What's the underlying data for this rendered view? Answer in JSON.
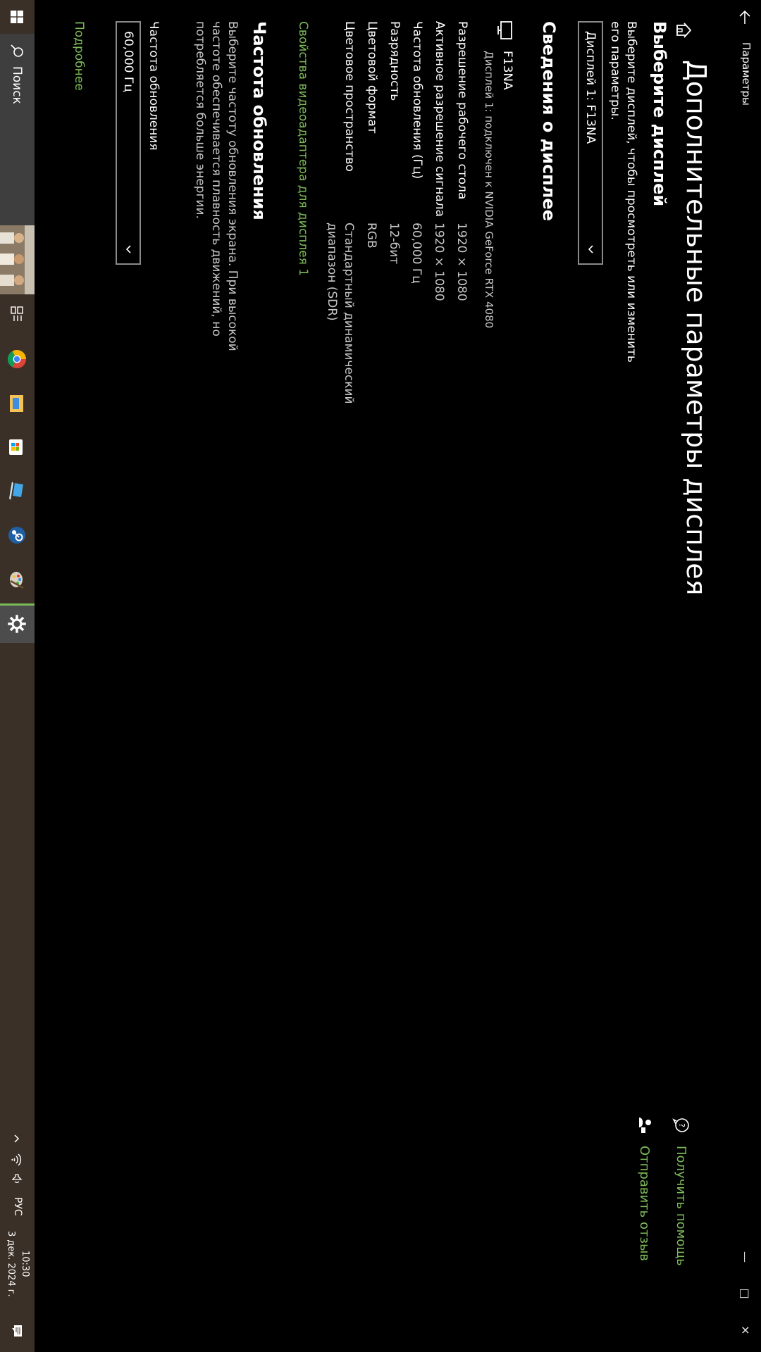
{
  "window": {
    "app_title": "Параметры",
    "minimize": "—",
    "restore": "□",
    "close": "✕"
  },
  "page": {
    "title": "Дополнительные параметры дисплея"
  },
  "help": {
    "get_help": "Получить помощь",
    "feedback": "Отправить отзыв"
  },
  "choose_display": {
    "heading": "Выберите дисплей",
    "description": "Выберите дисплей, чтобы просмотреть или изменить его параметры.",
    "selected": "Дисплей 1: F13NA"
  },
  "display_info": {
    "heading": "Сведения о дисплее",
    "name": "F13NA",
    "subtitle": "Дисплей 1: подключен к NVIDIA GeForce RTX 4080",
    "rows": [
      {
        "label": "Разрешение рабочего стола",
        "value": "1920 × 1080"
      },
      {
        "label": "Активное разрешение сигнала",
        "value": "1920 × 1080"
      },
      {
        "label": "Частота обновления (Гц)",
        "value": "60,000 Гц"
      },
      {
        "label": "Разрядность",
        "value": "12-бит"
      },
      {
        "label": "Цветовой формат",
        "value": "RGB"
      },
      {
        "label": "Цветовое пространство",
        "value": "Стандартный динамический диапазон (SDR)"
      }
    ],
    "adapter_link": "Свойства видеоадаптера для дисплея 1"
  },
  "refresh": {
    "heading": "Частота обновления",
    "description": "Выберите частоту обновления экрана. При высокой частоте обеспечивается плавность движений, но потребляется больше энергии.",
    "field_label": "Частота обновления",
    "selected": "60,000 Гц",
    "more_link": "Подробнее"
  },
  "taskbar": {
    "search_label": "Поиск",
    "language": "РУС",
    "time": "10:30",
    "date": "3 дек. 2024 г."
  },
  "colors": {
    "accent": "#7cba59",
    "background": "#000000",
    "taskbar": "#3b3027"
  }
}
